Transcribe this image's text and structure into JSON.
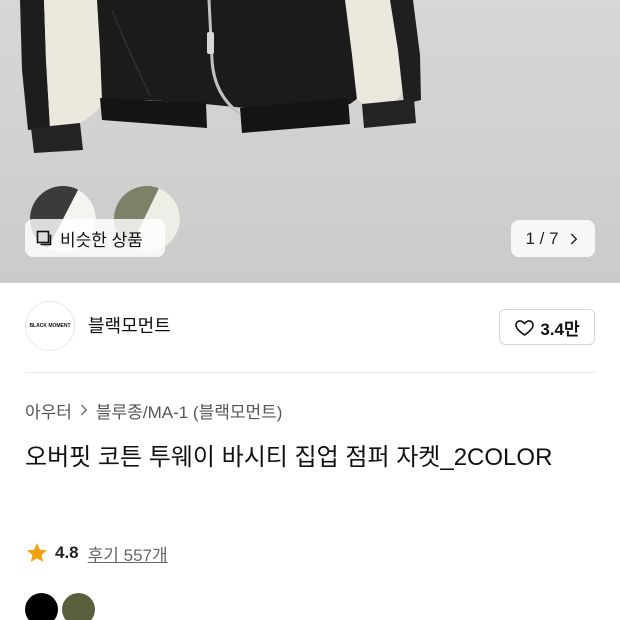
{
  "photo": {
    "thumbnails": [
      {
        "primary": "#3b3b3b",
        "secondary": "#f4f4f1"
      },
      {
        "primary": "#7c8168",
        "secondary": "#eeeee6"
      }
    ]
  },
  "gallery": {
    "similar_products_icon": "square-stack-icon",
    "similar_products_label": "비슷한 상품",
    "counter": "1 / 7",
    "next_icon": "chevron-right-icon"
  },
  "brand": {
    "logo_text": "BLACK MOMENT",
    "name": "블랙모먼트",
    "like_icon": "heart-outline-icon",
    "like_count": "3.4만"
  },
  "breadcrumb": {
    "category": "아우터",
    "separator_icon": "chevron-right-icon",
    "subcategory": "블루종/MA-1 (블랙모먼트)"
  },
  "product": {
    "title": "오버핏 코튼 투웨이 바시티 집업 점퍼 자켓_2COLOR"
  },
  "rating": {
    "star_icon": "star-icon",
    "star_color": "#f5a00f",
    "score": "4.8",
    "reviews": "후기 557개"
  },
  "color_options": [
    "#000000",
    "#5b5e3d"
  ]
}
